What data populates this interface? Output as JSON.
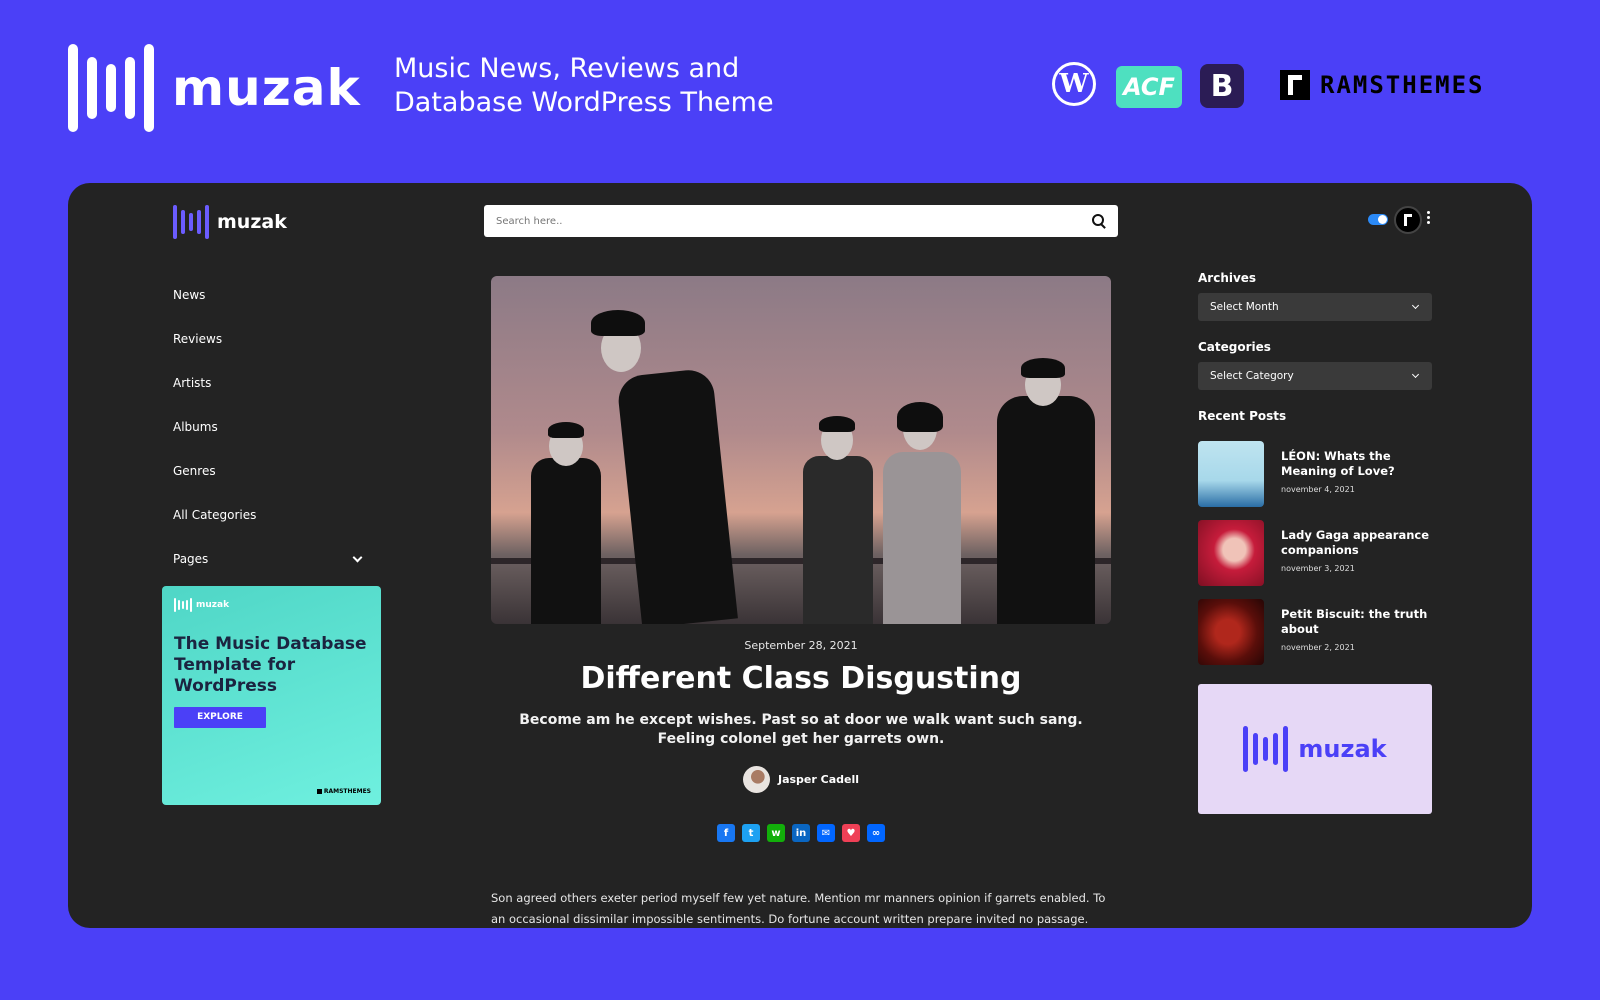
{
  "promo": {
    "brand": "muzak",
    "tagline": "Music News, Reviews and Database WordPress Theme",
    "tech_icons": [
      "wordpress-logo",
      "acf-logo",
      "bootstrap-logo"
    ],
    "acf_label": "ACF",
    "bootstrap_label": "B",
    "vendor": "RAMSTHEMES"
  },
  "colors": {
    "background": "#4b40f7",
    "screen": "#232323",
    "accent": "#4b40f7",
    "toggle": "#2b8af7"
  },
  "header": {
    "brand": "muzak",
    "search_placeholder": "Search here..",
    "icons": [
      "search-icon",
      "theme-toggle",
      "user-avatar",
      "more-vertical-icon"
    ]
  },
  "nav": {
    "items": [
      {
        "label": "News"
      },
      {
        "label": "Reviews"
      },
      {
        "label": "Artists"
      },
      {
        "label": "Albums"
      },
      {
        "label": "Genres"
      },
      {
        "label": "All Categories"
      },
      {
        "label": "Pages",
        "has_submenu": true
      }
    ]
  },
  "ad": {
    "brand": "muzak",
    "text": "The Music Database Template for WordPress",
    "button": "EXPLORE",
    "vendor": "RAMSTHEMES"
  },
  "post": {
    "date": "September 28, 2021",
    "title": "Different Class Disgusting",
    "lead": "Become am he except wishes. Past so at door we walk want such sang. Feeling colonel get her garrets own.",
    "author": "Jasper Cadell",
    "share_icons": [
      "facebook-icon",
      "twitter-icon",
      "whatsapp-icon",
      "linkedin-icon",
      "email-icon",
      "pocket-icon",
      "copy-link-icon"
    ],
    "body": "Son agreed others exeter period myself few yet nature. Mention mr manners opinion if garrets enabled. To an occasional dissimilar impossible sentiments. Do fortune account written prepare invited no passage. Garrets"
  },
  "sidebar": {
    "archives_title": "Archives",
    "archives_value": "Select Month",
    "categories_title": "Categories",
    "categories_value": "Select Category",
    "recent_title": "Recent Posts",
    "recent": [
      {
        "title": "LÉON: Whats the Meaning of Love?",
        "date": "november 4, 2021"
      },
      {
        "title": "Lady Gaga appearance companions",
        "date": "november 3, 2021"
      },
      {
        "title": "Petit Biscuit: the truth about",
        "date": "november 2, 2021"
      }
    ],
    "banner_brand": "muzak"
  }
}
